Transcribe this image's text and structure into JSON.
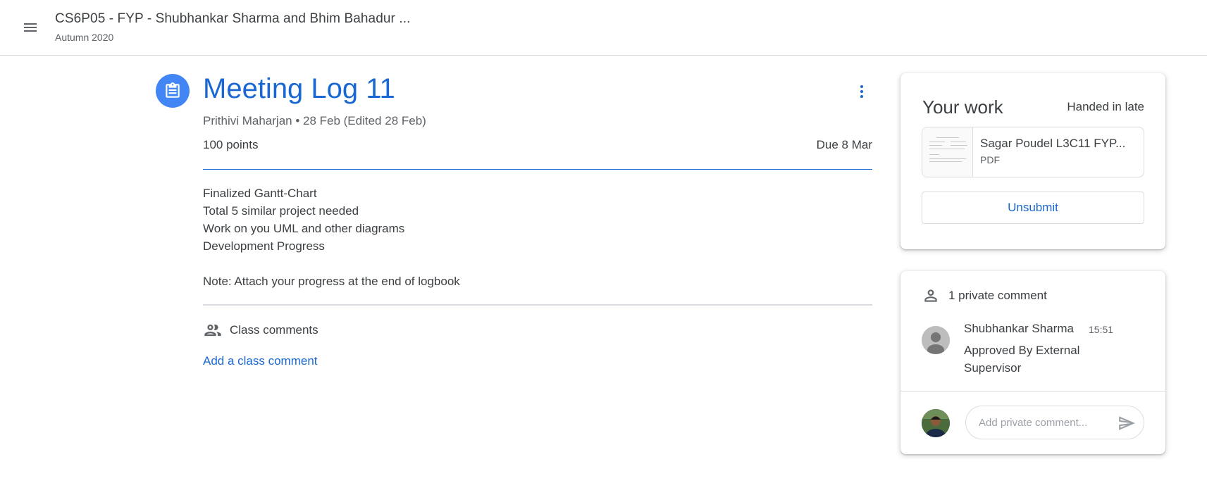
{
  "header": {
    "course_title": "CS6P05 - FYP - Shubhankar Sharma and Bhim Bahadur ...",
    "course_subtitle": "Autumn 2020"
  },
  "assignment": {
    "title": "Meeting Log 11",
    "meta": "Prithivi Maharjan • 28 Feb (Edited 28 Feb)",
    "points": "100 points",
    "due": "Due 8 Mar",
    "description_lines": [
      "Finalized Gantt-Chart",
      "Total 5 similar project needed",
      "Work on you UML and other diagrams",
      "Development Progress"
    ],
    "note": "Note: Attach your progress at the end of logbook"
  },
  "class_comments": {
    "label": "Class comments",
    "add_label": "Add a class comment"
  },
  "your_work": {
    "title": "Your work",
    "status": "Handed in late",
    "attachment": {
      "name": "Sagar Poudel L3C11 FYP...",
      "type": "PDF"
    },
    "unsubmit_label": "Unsubmit"
  },
  "private_comments": {
    "header": "1 private comment",
    "comments": [
      {
        "author": "Shubhankar Sharma",
        "time": "15:51",
        "text": "Approved By External Supervisor"
      }
    ],
    "input_placeholder": "Add private comment..."
  },
  "colors": {
    "accent": "#1967d2",
    "icon_bg": "#4285f4",
    "text": "#3c4043",
    "muted": "#5f6368",
    "border": "#dadce0"
  },
  "icons": {
    "menu": "hamburger-menu-icon",
    "assignment": "assignment-clipboard-icon",
    "more": "more-vert-icon",
    "class_comments": "people-icon",
    "private_comments": "person-icon",
    "send": "send-icon"
  }
}
